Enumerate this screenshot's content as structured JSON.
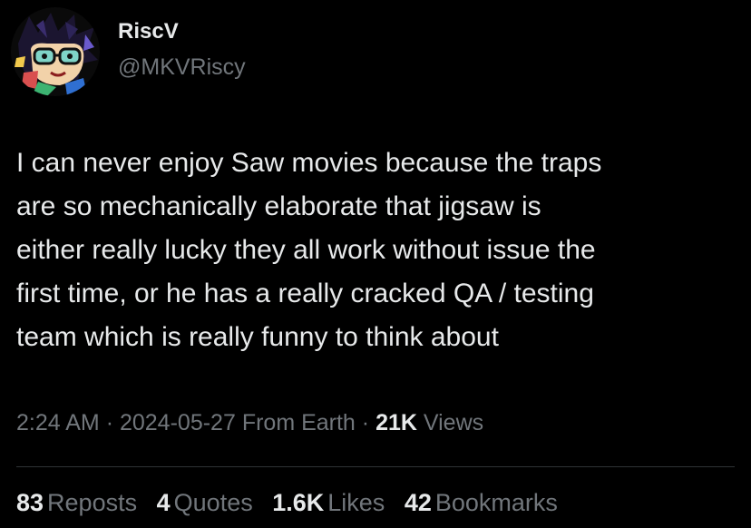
{
  "colors": {
    "background": "#000000",
    "primary_text": "#e7e9ea",
    "secondary_text": "#71767b",
    "divider": "#2f3336"
  },
  "author": {
    "display_name": "RiscV",
    "handle": "@MKVRiscy",
    "avatar_icon": "cartoon-character-avatar"
  },
  "tweet": {
    "lines": [
      "I can never enjoy Saw movies because the traps",
      "are so mechanically elaborate that jigsaw is",
      "either really lucky they all work without issue the",
      "first time, or he has a really cracked QA / testing",
      "team which is really funny to think about"
    ]
  },
  "meta": {
    "time": "2:24 AM",
    "separator": "·",
    "date": "2024-05-27",
    "source": "From Earth",
    "views_count": "21K",
    "views_label": "Views"
  },
  "stats": {
    "reposts_count": "83",
    "reposts_label": "Reposts",
    "quotes_count": "4",
    "quotes_label": "Quotes",
    "likes_count": "1.6K",
    "likes_label": "Likes",
    "bookmarks_count": "42",
    "bookmarks_label": "Bookmarks"
  }
}
